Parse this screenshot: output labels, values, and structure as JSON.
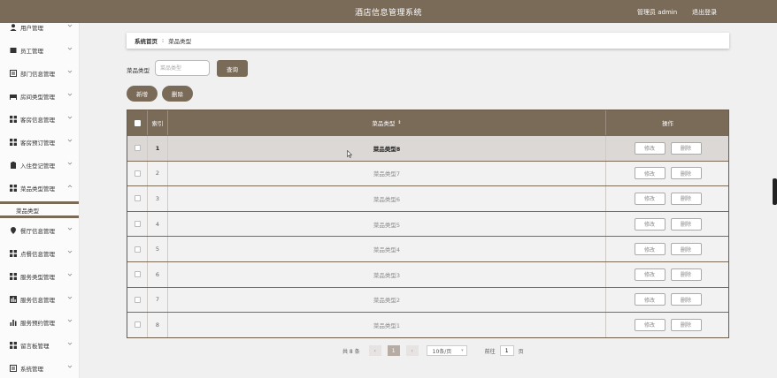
{
  "header": {
    "title": "酒店信息管理系统",
    "user": "管理员 admin",
    "logout": "退出登录",
    "color": "#7a6a58"
  },
  "sidebar": {
    "items": [
      {
        "label": "用户管理",
        "icon": "person-icon"
      },
      {
        "label": "员工管理",
        "icon": "id-card-icon"
      },
      {
        "label": "部门信息管理",
        "icon": "list-icon"
      },
      {
        "label": "房间类型管理",
        "icon": "bed-icon"
      },
      {
        "label": "客房信息管理",
        "icon": "grid-icon"
      },
      {
        "label": "客房预订管理",
        "icon": "grid-icon"
      },
      {
        "label": "入住登记管理",
        "icon": "clipboard-icon"
      },
      {
        "label": "菜品类型管理",
        "icon": "grid-icon"
      },
      {
        "label": "餐厅信息管理",
        "icon": "pin-icon"
      },
      {
        "label": "点餐信息管理",
        "icon": "grid-icon"
      },
      {
        "label": "服务类型管理",
        "icon": "grid-icon"
      },
      {
        "label": "服务信息管理",
        "icon": "chart-icon"
      },
      {
        "label": "服务预约管理",
        "icon": "bar-chart-icon"
      },
      {
        "label": "留言板管理",
        "icon": "grid-icon"
      },
      {
        "label": "系统管理",
        "icon": "list-icon"
      }
    ],
    "submenu_label": "菜品类型"
  },
  "breadcrumb": {
    "home": "系统首页",
    "current": "菜品类型"
  },
  "search": {
    "label": "菜品类型",
    "placeholder": "菜品类型",
    "query_button": "查询"
  },
  "actions": {
    "add": "新增",
    "delete": "删除"
  },
  "table": {
    "headers": {
      "index": "索引",
      "name": "菜品类型",
      "operation": "操作",
      "sort": "⇕"
    },
    "rows": [
      {
        "index": "1",
        "name": "菜品类型8"
      },
      {
        "index": "2",
        "name": "菜品类型7"
      },
      {
        "index": "3",
        "name": "菜品类型6"
      },
      {
        "index": "4",
        "name": "菜品类型5"
      },
      {
        "index": "5",
        "name": "菜品类型4"
      },
      {
        "index": "6",
        "name": "菜品类型3"
      },
      {
        "index": "7",
        "name": "菜品类型2"
      },
      {
        "index": "8",
        "name": "菜品类型1"
      }
    ],
    "edit_label": "修改",
    "delete_label": "删除"
  },
  "pagination": {
    "total": "共 8 条",
    "prev": "‹",
    "current_page": "1",
    "next": "›",
    "page_size": "10条/页",
    "goto_label": "前往",
    "goto_value": "1",
    "page_suffix": "页"
  }
}
